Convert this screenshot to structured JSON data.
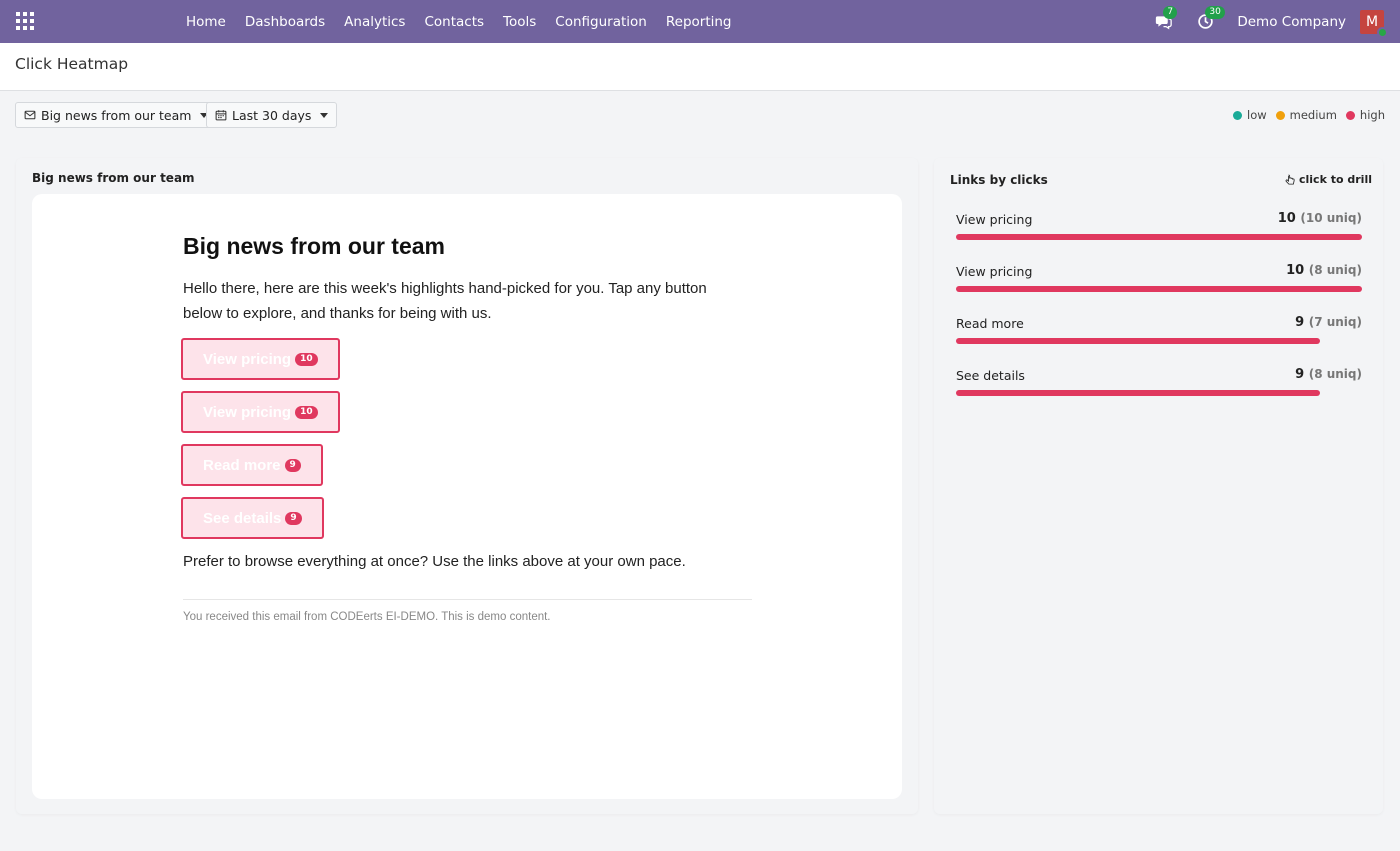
{
  "nav": {
    "menu": [
      "Home",
      "Dashboards",
      "Analytics",
      "Contacts",
      "Tools",
      "Configuration",
      "Reporting"
    ],
    "messages_count": "7",
    "activities_count": "30",
    "company": "Demo Company",
    "avatar_initial": "M"
  },
  "page": {
    "title": "Click Heatmap"
  },
  "filters": {
    "mailing": "Big news from our team",
    "period": "Last 30 days"
  },
  "legend": [
    {
      "label": "low",
      "color": "#1aab98"
    },
    {
      "label": "medium",
      "color": "#f0a00c"
    },
    {
      "label": "high",
      "color": "#e0385f"
    }
  ],
  "preview": {
    "heading": "Big news from our team",
    "email_title": "Big news from our team",
    "intro": "Hello there, here are this week's highlights hand-picked for you. Tap any button below to explore, and thanks for being with us.",
    "buttons": [
      {
        "label": "View pricing",
        "count": "10"
      },
      {
        "label": "View pricing",
        "count": "10"
      },
      {
        "label": "Read more",
        "count": "9"
      },
      {
        "label": "See details",
        "count": "9"
      }
    ],
    "outro": "Prefer to browse everything at once? Use the links above at your own pace.",
    "footer": "You received this email from CODEerts EI-DEMO. This is demo content."
  },
  "links_panel": {
    "heading": "Links by clicks",
    "drill_label": "click to drill",
    "bar_color": "#e0385f",
    "rows": [
      {
        "label": "View pricing",
        "clicks": 10,
        "clicks_text": "10",
        "uniq_text": "(10 uniq)"
      },
      {
        "label": "View pricing",
        "clicks": 10,
        "clicks_text": "10",
        "uniq_text": "(8 uniq)"
      },
      {
        "label": "Read more",
        "clicks": 9,
        "clicks_text": "9",
        "uniq_text": "(7 uniq)"
      },
      {
        "label": "See details",
        "clicks": 9,
        "clicks_text": "9",
        "uniq_text": "(8 uniq)"
      }
    ]
  }
}
